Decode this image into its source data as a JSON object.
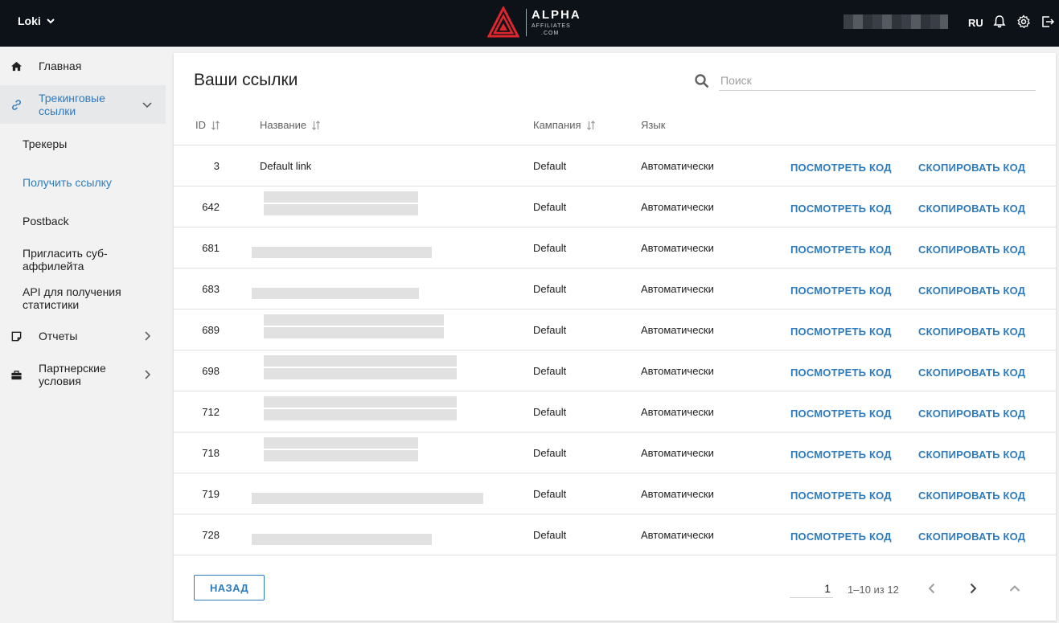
{
  "header": {
    "user": "Loki",
    "logo_main": "ALPHA",
    "logo_sub": "AFFILIATES",
    "logo_com": ".COM",
    "lang": "RU"
  },
  "sidebar": {
    "items": [
      {
        "label": "Главная"
      },
      {
        "label": "Трекинговые ссылки"
      },
      {
        "label": "Отчеты"
      },
      {
        "label": "Партнерские условия"
      }
    ],
    "sub": [
      {
        "label": "Трекеры"
      },
      {
        "label": "Получить ссылку"
      },
      {
        "label": "Postback"
      },
      {
        "label": "Пригласить суб-аффилейта"
      },
      {
        "label": "API для получения статистики"
      }
    ]
  },
  "main": {
    "title": "Ваши ссылки",
    "search_placeholder": "Поиск",
    "columns": {
      "id": "ID",
      "name": "Название",
      "campaign": "Кампания",
      "lang": "Язык"
    },
    "actions": {
      "view": "ПОСМОТРЕТЬ КОД",
      "copy": "СКОПИРОВАТЬ КОД"
    },
    "rows": [
      {
        "id": "3",
        "name": "Default link",
        "campaign": "Default",
        "lang": "Автоматически"
      },
      {
        "id": "642",
        "name": "",
        "campaign": "Default",
        "lang": "Автоматически"
      },
      {
        "id": "681",
        "name": "",
        "campaign": "Default",
        "lang": "Автоматически"
      },
      {
        "id": "683",
        "name": "",
        "campaign": "Default",
        "lang": "Автоматически"
      },
      {
        "id": "689",
        "name": "",
        "campaign": "Default",
        "lang": "Автоматически"
      },
      {
        "id": "698",
        "name": "",
        "campaign": "Default",
        "lang": "Автоматически"
      },
      {
        "id": "712",
        "name": "",
        "campaign": "Default",
        "lang": "Автоматически"
      },
      {
        "id": "718",
        "name": "",
        "campaign": "Default",
        "lang": "Автоматически"
      },
      {
        "id": "719",
        "name": "",
        "campaign": "Default",
        "lang": "Автоматически"
      },
      {
        "id": "728",
        "name": "",
        "campaign": "Default",
        "lang": "Автоматически"
      }
    ]
  },
  "footer": {
    "back": "НАЗАД",
    "page": "1",
    "range": "1–10 из 12"
  },
  "colors": {
    "accent": "#2e7bbd",
    "header_bg": "#0d1118",
    "logo_red": "#e0262d"
  }
}
